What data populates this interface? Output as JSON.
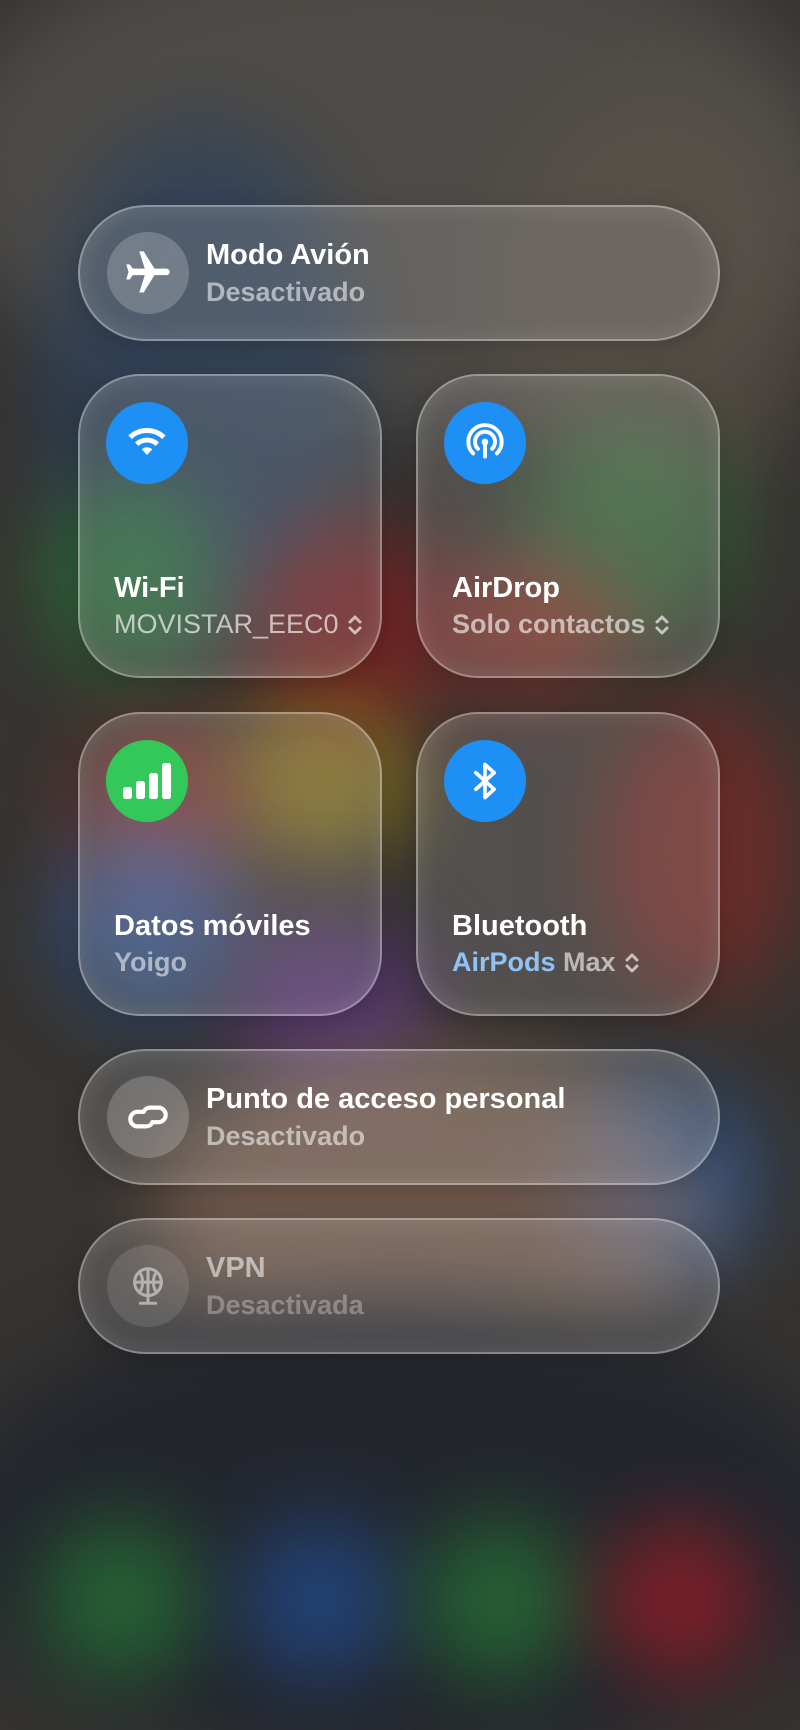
{
  "airplane": {
    "title": "Modo Avión",
    "status": "Desactivado"
  },
  "wifi": {
    "title": "Wi-Fi",
    "network": "MOVISTAR_EEC0"
  },
  "airdrop": {
    "title": "AirDrop",
    "mode": "Solo contactos"
  },
  "cellular": {
    "title": "Datos móviles",
    "carrier": "Yoigo"
  },
  "bluetooth": {
    "title": "Bluetooth",
    "device": "AirPods Max",
    "device_part1": "AirPods",
    "device_part2": " Max"
  },
  "hotspot": {
    "title": "Punto de acceso personal",
    "status": "Desactivado"
  },
  "vpn": {
    "title": "VPN",
    "status": "Desactivada"
  },
  "colors": {
    "accent_blue": "#1e8ff5",
    "cellular_green": "#34c759"
  },
  "icons": [
    "airplane-icon",
    "wifi-icon",
    "airdrop-icon",
    "cellular-signal-icon",
    "bluetooth-icon",
    "hotspot-link-icon",
    "vpn-globe-icon",
    "chevron-updown-icon"
  ]
}
